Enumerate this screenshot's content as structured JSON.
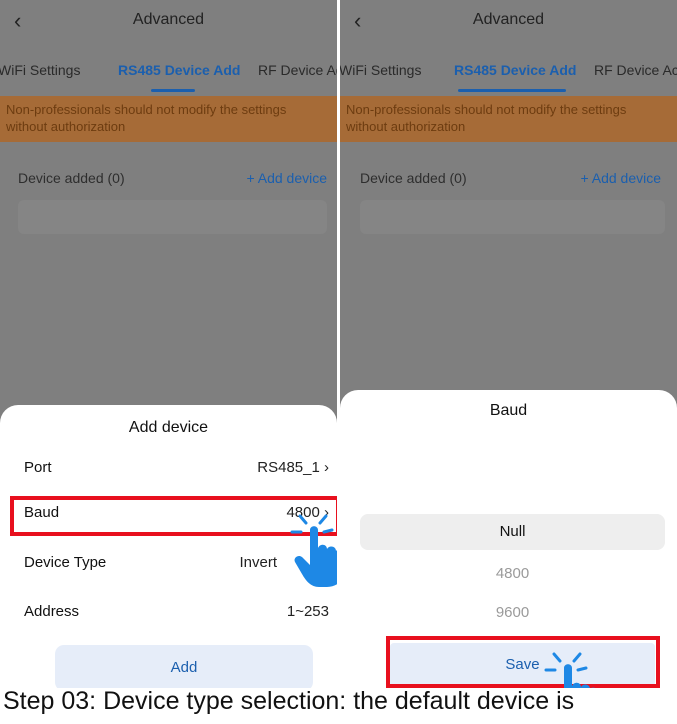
{
  "panels": [
    {
      "nav": {
        "back_icon": "chevron-left-icon",
        "back_glyph": "‹",
        "title": "Advanced"
      },
      "tabs": [
        "WiFi Settings",
        "RS485 Device Add",
        "RF Device Add"
      ],
      "warning": "Non-professionals should not modify the settings without authorization",
      "device_added": "Device added (0)",
      "add_device": "+ Add device",
      "sheet": {
        "title": "Add device",
        "rows": [
          {
            "label": "Port",
            "value": "RS485_1 ›"
          },
          {
            "label": "Baud",
            "value": "4800 ›"
          },
          {
            "label": "Device Type",
            "value": "Invert"
          },
          {
            "label": "Address",
            "value": "1~253"
          }
        ],
        "button": "Add"
      }
    },
    {
      "nav": {
        "back_icon": "chevron-left-icon",
        "back_glyph": "‹",
        "title": "Advanced"
      },
      "tabs": [
        "WiFi Settings",
        "RS485 Device Add",
        "RF Device Ac"
      ],
      "warning": "Non-professionals should not modify the settings without authorization",
      "device_added": "Device added (0)",
      "add_device": "+ Add device",
      "sheet": {
        "title": "Baud",
        "options": [
          "Null",
          "4800",
          "9600"
        ],
        "selected": "Null",
        "button": "Save"
      }
    }
  ],
  "caption": "Step 03: Device type selection: the default device is",
  "colors": {
    "accent": "#1b5fae",
    "highlight": "#e8101e",
    "overlay": "#7f7f7f",
    "warning_bg": "#a66b37"
  },
  "icons": {
    "pointer": "pointing-hand-icon"
  }
}
